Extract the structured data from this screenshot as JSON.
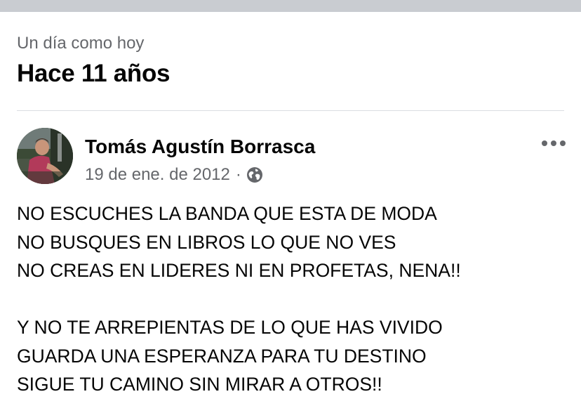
{
  "memory": {
    "subtitle": "Un día como hoy",
    "title": "Hace 11 años"
  },
  "post": {
    "author": "Tomás Agustín Borrasca",
    "date": "19 de ene. de 2012",
    "separator": "·",
    "privacy_icon": "globe-icon",
    "menu_icon": "more-dots-icon",
    "paragraph1": [
      "NO ESCUCHES LA BANDA QUE ESTA DE MODA",
      "NO BUSQUES EN LIBROS LO QUE NO VES",
      "NO CREAS EN LIDERES NI EN PROFETAS, NENA!!"
    ],
    "paragraph2": [
      "Y NO TE ARREPIENTAS DE LO QUE HAS VIVIDO",
      "GUARDA UNA ESPERANZA PARA TU DESTINO",
      "SIGUE TU CAMINO SIN MIRAR A OTROS!!"
    ]
  },
  "colors": {
    "text_primary": "#050505",
    "text_secondary": "#65676b",
    "top_bar": "#c9ccd1",
    "divider": "#dadde1"
  }
}
